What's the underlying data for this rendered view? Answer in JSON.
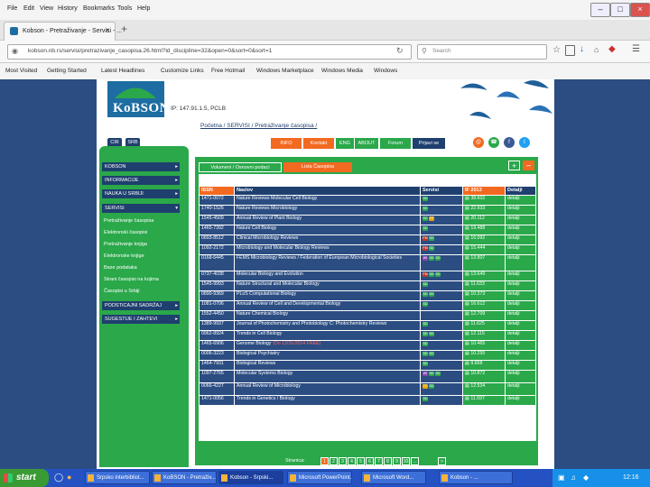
{
  "menubar": {
    "items": [
      "File",
      "Edit",
      "View",
      "History",
      "Bookmarks",
      "Tools",
      "Help"
    ]
  },
  "tab": {
    "title": "Kobson - Pretraživanje - Servisi - ..."
  },
  "navbar": {
    "url": "kobson.nb.rs/servisi/pretrazivanje_casopisa.26.html?id_discipline=32&open=0&sort=0&sort=1",
    "search_placeholder": "Search"
  },
  "bookmarks": [
    "Most Visited",
    "Getting Started",
    "Latest Headlines",
    "Customize Links",
    "Free Hotmail",
    "Windows Marketplace",
    "Windows Media",
    "Windows"
  ],
  "site": {
    "logo_text": "KoBSON",
    "ip_line": "IP: 147.91.1.5, PCLB",
    "breadcrumb": "Početna / SERVISI / Pretraživanje časopisa /",
    "lang": [
      "CIR",
      "SRB"
    ]
  },
  "top_tabs": [
    "INFO",
    "Kontakt",
    "ENG",
    "ABOUT",
    "Forum",
    "Prijavi se"
  ],
  "left_nav": [
    {
      "label": "KOBSON",
      "sub": []
    },
    {
      "label": "INFORMACIJE",
      "sub": []
    },
    {
      "label": "NAUKA U SRBIJI",
      "sub": []
    },
    {
      "label": "SERVISI",
      "sub": [
        "Pretraživanje časopisa",
        "Elektronski časopisi",
        "Pretraživanje knjiga",
        "Elektronske knjige",
        "Baze podataka",
        "Strani časopisi na kojima",
        "Časopisi u Srbiji"
      ]
    },
    {
      "label": "PODSTICAJNI SADRŽAJ",
      "sub": []
    },
    {
      "label": "SUGESTIJE I ZAHTEVI",
      "sub": []
    }
  ],
  "subtabs": [
    "Volumeni / Osnovni podaci",
    "Lista Časopisa"
  ],
  "table": {
    "headers": [
      "ISSN",
      "Naslov",
      "Servisi",
      "IF 2013",
      "Detalji"
    ],
    "rows": [
      {
        "issn": "1471-0072",
        "title": "Nature Reviews Molecular Cell Biology",
        "servisi": [
          "SD"
        ],
        "if": "38.602",
        "det": "detalji"
      },
      {
        "issn": "1740-1526",
        "title": "Nature Reviews Microbiology",
        "servisi": [
          "SD"
        ],
        "if": "22.933",
        "det": "detalji"
      },
      {
        "issn": "1545-4509",
        "title": "Annual Review of Plant Biology",
        "servisi": [
          "SD",
          "TF"
        ],
        "if": "20.112",
        "det": "detalji"
      },
      {
        "issn": "1465-7392",
        "title": "Nature Cell Biology",
        "servisi": [
          "SD"
        ],
        "if": "19.488",
        "det": "detalji"
      },
      {
        "issn": "0893-8512",
        "title": "Clinical Microbiology Reviews",
        "servisi": [
          "FM",
          "SD"
        ],
        "if": "16.092",
        "det": "detalji"
      },
      {
        "issn": "1092-2172",
        "title": "Microbiology and Molecular Biology Reviews",
        "servisi": [
          "FM",
          "SD"
        ],
        "if": "15.444",
        "det": "detalji"
      },
      {
        "issn": "0168-6445",
        "title": "FEMS Microbiology Reviews / Federation of European Microbiological Societies",
        "servisi": [
          "WI",
          "SD",
          "SD"
        ],
        "if": "13.807",
        "det": "detalji"
      },
      {
        "issn": "0737-4038",
        "title": "Molecular Biology and Evolution",
        "servisi": [
          "FM",
          "SD",
          "SD"
        ],
        "if": "13.649",
        "det": "detalji"
      },
      {
        "issn": "1545-9993",
        "title": "Nature Structural and Molecular Biology",
        "servisi": [
          "SD"
        ],
        "if": "11.633",
        "det": "detalji"
      },
      {
        "issn": "0890-9369",
        "title": "PLoS Computational Biology",
        "servisi": [
          "SD",
          "SD"
        ],
        "if": "10.373",
        "det": "detalji"
      },
      {
        "issn": "1081-0706",
        "title": "Annual Review of Cell and Developmental Biology",
        "servisi": [
          "SD"
        ],
        "if": "16.612",
        "det": "detalji"
      },
      {
        "issn": "1552-4450",
        "title": "Nature Chemical Biology",
        "servisi": [],
        "if": "12.709",
        "det": "detalji"
      },
      {
        "issn": "1389-9937",
        "title": "Journal of Photochemistry and Photobiology C: Photochemistry Reviews",
        "servisi": [
          "SD"
        ],
        "if": "11.625",
        "det": "detalji"
      },
      {
        "issn": "0962-8924",
        "title": "Trends in Cell Biology",
        "servisi": [
          "SD",
          "SD"
        ],
        "if": "12.115",
        "det": "detalji"
      },
      {
        "issn": "1465-6906",
        "title": "Genome Biology",
        "title_note": "(Do 12/31/2014 FREE)",
        "servisi": [
          "SD"
        ],
        "if": "10.465",
        "det": "detalji"
      },
      {
        "issn": "0006-3223",
        "title": "Biological Psychiatry",
        "servisi": [
          "SD",
          "SD"
        ],
        "if": "10.255",
        "det": "detalji"
      },
      {
        "issn": "1464-7931",
        "title": "Biological Reviews",
        "servisi": [
          "SD"
        ],
        "if": "9.668",
        "det": "detalji"
      },
      {
        "issn": "1097-2765",
        "title": "Molecular Systems Biology",
        "servisi": [
          "WI",
          "SD",
          "SD"
        ],
        "if": "10.872",
        "det": "detalji"
      },
      {
        "issn": "0066-4227",
        "title": "Annual Review of Microbiology",
        "servisi": [
          "TF",
          "SD"
        ],
        "if": "12.534",
        "det": "detalji"
      },
      {
        "issn": "1471-0056",
        "title": "Trends in Genetics / Biology",
        "servisi": [
          "SD"
        ],
        "if": "11.597",
        "det": "detalji"
      }
    ]
  },
  "pagination": {
    "label": "Stranica:",
    "pages": [
      "1",
      "2",
      "3",
      "4",
      "5",
      "6",
      "7",
      "8",
      "9",
      "10",
      "..."
    ],
    "next": ">"
  },
  "taskbar": {
    "start": "start",
    "tasks": [
      "Srpsko interbibliot...",
      "KoBSON - Pretraživ...",
      "Kobson - Srpski...",
      "Microsoft PowerPoint...",
      "Microsoft Word...",
      "Kobson - ..."
    ],
    "clock": "12:16"
  },
  "colors": {
    "navy": "#2b4d82",
    "green": "#2aa84a",
    "orange": "#f26a21",
    "taskbar": "#2452c2"
  }
}
